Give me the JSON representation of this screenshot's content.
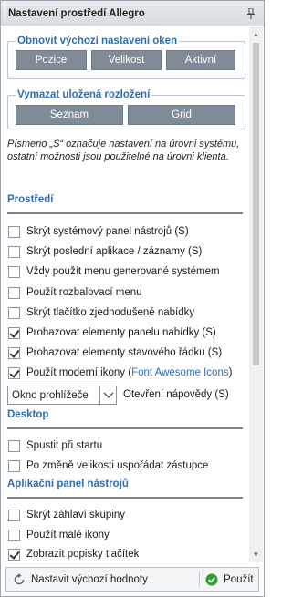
{
  "panel": {
    "title": "Nastavení prostředí Allegro"
  },
  "window_reset": {
    "legend": "Obnovit výchozí nastavení oken",
    "buttons": [
      "Pozice",
      "Velikost",
      "Aktivní"
    ]
  },
  "layout_delete": {
    "legend": "Vymazat uložená rozložení",
    "buttons": [
      "Seznam",
      "Grid"
    ]
  },
  "note": "Písmeno „S“ označuje nastavení na úrovni systému, ostatní možnosti jsou použitelné na úrovni klienta.",
  "sections": {
    "environment": "Prostředí",
    "desktop": "Desktop",
    "toolbar": "Aplikační panel nástrojů"
  },
  "environment_options": [
    {
      "label": "Skrýt systémový panel nástrojů (S)",
      "checked": false
    },
    {
      "label": "Skrýt poslední aplikace / záznamy (S)",
      "checked": false
    },
    {
      "label": "Vždy použít menu generované systémem",
      "checked": false
    },
    {
      "label": "Použít rozbalovací menu",
      "checked": false
    },
    {
      "label": "Skrýt tlačítko zjednodušené nabídky",
      "checked": false
    },
    {
      "label": "Prohazovat elementy panelu nabídky (S)",
      "checked": true
    },
    {
      "label": "Prohazovat elementy stavového řádku (S)",
      "checked": true
    },
    {
      "label": "Použít moderní ikony (",
      "link": "Font Awesome Icons",
      "suffix": ")",
      "checked": true
    }
  ],
  "help_select": {
    "value": "Okno prohlížeče",
    "label": "Otevření nápovědy (S)"
  },
  "desktop_options": [
    {
      "label": "Spustit při startu",
      "checked": false
    },
    {
      "label": "Po změně velikosti uspořádat zástupce",
      "checked": false
    }
  ],
  "toolbar_options": [
    {
      "label": "Skrýt záhlaví skupiny",
      "checked": false
    },
    {
      "label": "Použít malé ikony",
      "checked": false
    },
    {
      "label": "Zobrazit popisky tlačítek",
      "checked": true
    }
  ],
  "footer": {
    "reset_label": "Nastavit výchozí hodnoty",
    "apply_label": "Použít"
  },
  "colors": {
    "accent": "#2f6db5",
    "button_bg": "#7f8b97",
    "apply_icon": "#2aa52a"
  }
}
